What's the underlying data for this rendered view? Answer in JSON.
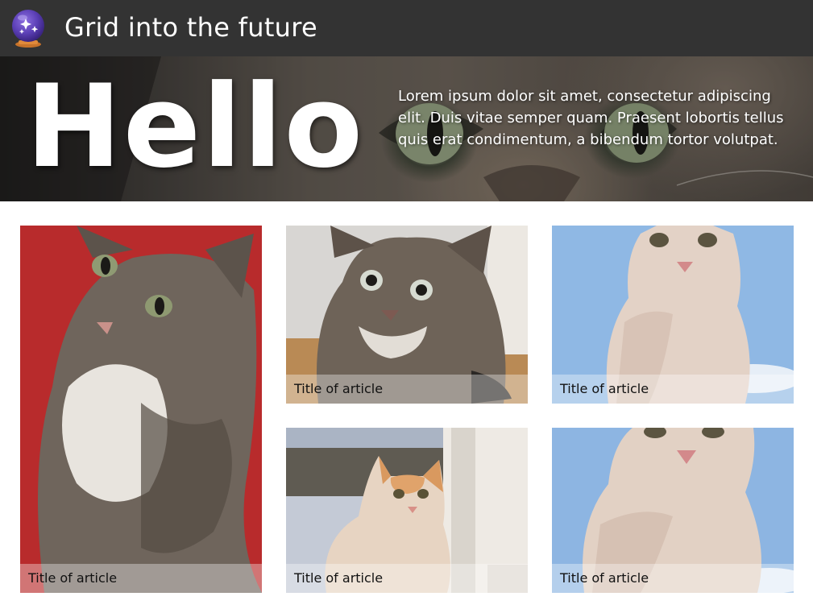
{
  "header": {
    "logo_icon": "crystal-ball-icon",
    "title": "Grid into the future",
    "background": "#333333"
  },
  "hero": {
    "heading": "Hello",
    "text": "Lorem ipsum dolor sit amet, consectetur adipiscing elit. Duis vitae semper quam. Praesent lobortis tellus quis erat condimentum, a bibendum tortor volutpat."
  },
  "articles": [
    {
      "title": "Title of article",
      "image": "tabby-kitten-red-background"
    },
    {
      "title": "Title of article",
      "image": "tabby-kitten-closeup"
    },
    {
      "title": "Title of article",
      "image": "white-cat-blue-sky"
    },
    {
      "title": "Title of article",
      "image": "orange-white-cat-by-door"
    },
    {
      "title": "Title of article",
      "image": "white-cat-blue-sky"
    }
  ]
}
